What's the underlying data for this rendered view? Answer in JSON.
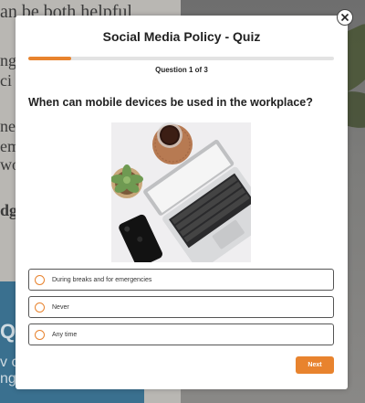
{
  "background": {
    "text_lines": [
      "an be both helpful",
      "ng le",
      "ci",
      "ne,",
      "em",
      "wo",
      "dg"
    ],
    "blue_panel_lines": [
      "Q",
      "v c",
      "ng"
    ]
  },
  "modal": {
    "title": "Social Media Policy - Quiz",
    "progress": {
      "label": "Question 1 of 3",
      "current": 1,
      "total": 3,
      "fraction": 0.14
    },
    "question": "When can mobile devices be used in the workplace?",
    "options": [
      {
        "label": "During breaks and for emergencies"
      },
      {
        "label": "Never"
      },
      {
        "label": "Any time"
      }
    ],
    "next_label": "Next"
  },
  "colors": {
    "accent": "#e8832e",
    "text": "#222222"
  },
  "icons": {
    "close": "close-icon",
    "radio": "radio-button-icon"
  }
}
